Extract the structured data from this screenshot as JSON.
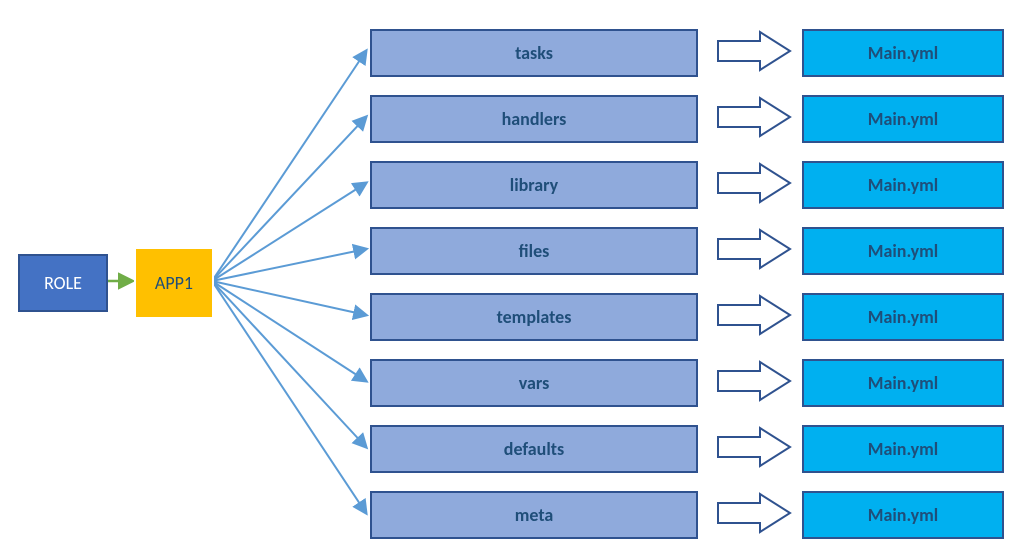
{
  "role": {
    "label": "ROLE"
  },
  "app": {
    "label": "APP1"
  },
  "directories": [
    {
      "label": "tasks",
      "file": "Main.yml"
    },
    {
      "label": "handlers",
      "file": "Main.yml"
    },
    {
      "label": "library",
      "file": "Main.yml"
    },
    {
      "label": "files",
      "file": "Main.yml"
    },
    {
      "label": "templates",
      "file": "Main.yml"
    },
    {
      "label": "vars",
      "file": "Main.yml"
    },
    {
      "label": "defaults",
      "file": "Main.yml"
    },
    {
      "label": "meta",
      "file": "Main.yml"
    }
  ],
  "colors": {
    "role_bg": "#4472c4",
    "app_bg": "#ffc000",
    "dir_bg": "#8faadc",
    "file_bg": "#00b0f0",
    "border": "#2f528f",
    "text_dark": "#1f4e79",
    "arrow_fan": "#5b9bd5",
    "arrow_green": "#70ad47"
  },
  "chart_data": {
    "type": "tree",
    "root": {
      "name": "ROLE",
      "children": [
        {
          "name": "APP1",
          "children": [
            {
              "name": "tasks",
              "children": [
                {
                  "name": "Main.yml"
                }
              ]
            },
            {
              "name": "handlers",
              "children": [
                {
                  "name": "Main.yml"
                }
              ]
            },
            {
              "name": "library",
              "children": [
                {
                  "name": "Main.yml"
                }
              ]
            },
            {
              "name": "files",
              "children": [
                {
                  "name": "Main.yml"
                }
              ]
            },
            {
              "name": "templates",
              "children": [
                {
                  "name": "Main.yml"
                }
              ]
            },
            {
              "name": "vars",
              "children": [
                {
                  "name": "Main.yml"
                }
              ]
            },
            {
              "name": "defaults",
              "children": [
                {
                  "name": "Main.yml"
                }
              ]
            },
            {
              "name": "meta",
              "children": [
                {
                  "name": "Main.yml"
                }
              ]
            }
          ]
        }
      ]
    }
  }
}
